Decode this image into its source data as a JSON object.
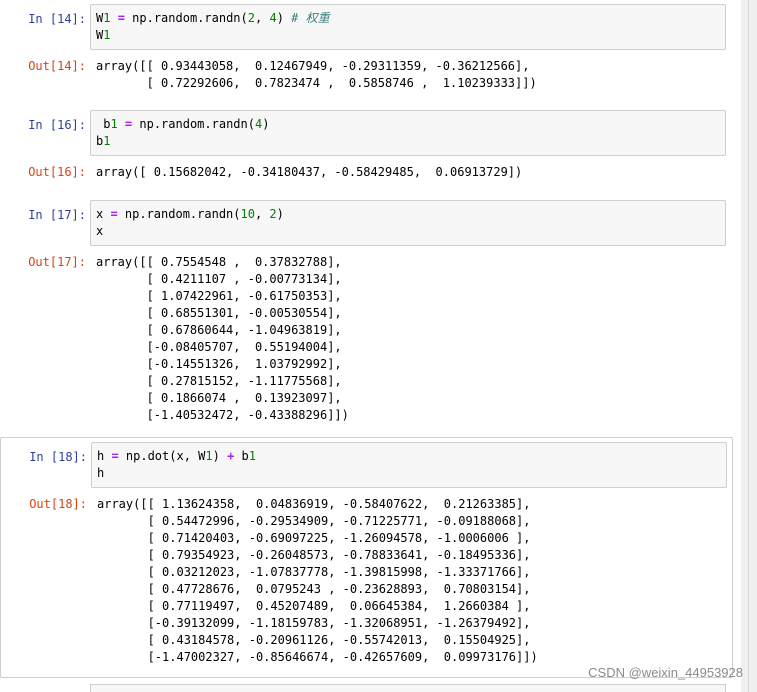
{
  "cells": [
    {
      "in_prompt": "In  [14]:",
      "code_lines": [
        [
          {
            "t": "nm",
            "v": "W1 "
          },
          {
            "t": "eq",
            "v": "="
          },
          {
            "t": "nm",
            "v": " np.random.randn(2, 4) "
          },
          {
            "t": "cmt",
            "v": "# 权重"
          }
        ],
        [
          {
            "t": "nm",
            "v": "W1"
          }
        ]
      ],
      "out_prompt": "Out[14]:",
      "output": "array([[ 0.93443058,  0.12467949, -0.29311359, -0.36212566],\n       [ 0.72292606,  0.7823474 ,  0.5858746 ,  1.10239333]])"
    },
    {
      "in_prompt": "In  [16]:",
      "code_lines": [
        [
          {
            "t": "nm",
            "v": " b1 "
          },
          {
            "t": "eq",
            "v": "="
          },
          {
            "t": "nm",
            "v": " np.random.randn(4)"
          }
        ],
        [
          {
            "t": "nm",
            "v": "b1"
          }
        ]
      ],
      "out_prompt": "Out[16]:",
      "output": "array([ 0.15682042, -0.34180437, -0.58429485,  0.06913729])"
    },
    {
      "in_prompt": "In  [17]:",
      "code_lines": [
        [
          {
            "t": "nm",
            "v": "x "
          },
          {
            "t": "eq",
            "v": "="
          },
          {
            "t": "nm",
            "v": " np.random.randn(10, 2)"
          }
        ],
        [
          {
            "t": "nm",
            "v": "x"
          }
        ]
      ],
      "out_prompt": "Out[17]:",
      "output": "array([[ 0.7554548 ,  0.37832788],\n       [ 0.4211107 , -0.00773134],\n       [ 1.07422961, -0.61750353],\n       [ 0.68551301, -0.00530554],\n       [ 0.67860644, -1.04963819],\n       [-0.08405707,  0.55194004],\n       [-0.14551326,  1.03792992],\n       [ 0.27815152, -1.11775568],\n       [ 0.1866074 ,  0.13923097],\n       [-1.40532472, -0.43388296]])"
    },
    {
      "in_prompt": "In  [18]:",
      "code_lines": [
        [
          {
            "t": "nm",
            "v": "h "
          },
          {
            "t": "eq",
            "v": "="
          },
          {
            "t": "nm",
            "v": " np.dot(x, W1) "
          },
          {
            "t": "op",
            "v": "+"
          },
          {
            "t": "nm",
            "v": " b1"
          }
        ],
        [
          {
            "t": "nm",
            "v": "h"
          }
        ]
      ],
      "out_prompt": "Out[18]:",
      "output": "array([[ 1.13624358,  0.04836919, -0.58407622,  0.21263385],\n       [ 0.54472996, -0.29534909, -0.71225771, -0.09188068],\n       [ 0.71420403, -0.69097225, -1.26094578, -1.0006006 ],\n       [ 0.79354923, -0.26048573, -0.78833641, -0.18495336],\n       [ 0.03212023, -1.07837778, -1.39815998, -1.33371766],\n       [ 0.47728676,  0.0795243 , -0.23628893,  0.70803154],\n       [ 0.77119497,  0.45207489,  0.06645384,  1.2660384 ],\n       [-0.39132099, -1.18159783, -1.32068951, -1.26379492],\n       [ 0.43184578, -0.20961126, -0.55742013,  0.15504925],\n       [-1.47002327, -0.85646674, -0.42657609,  0.09973176]])"
    }
  ],
  "watermark": "CSDN @weixin_44953928"
}
